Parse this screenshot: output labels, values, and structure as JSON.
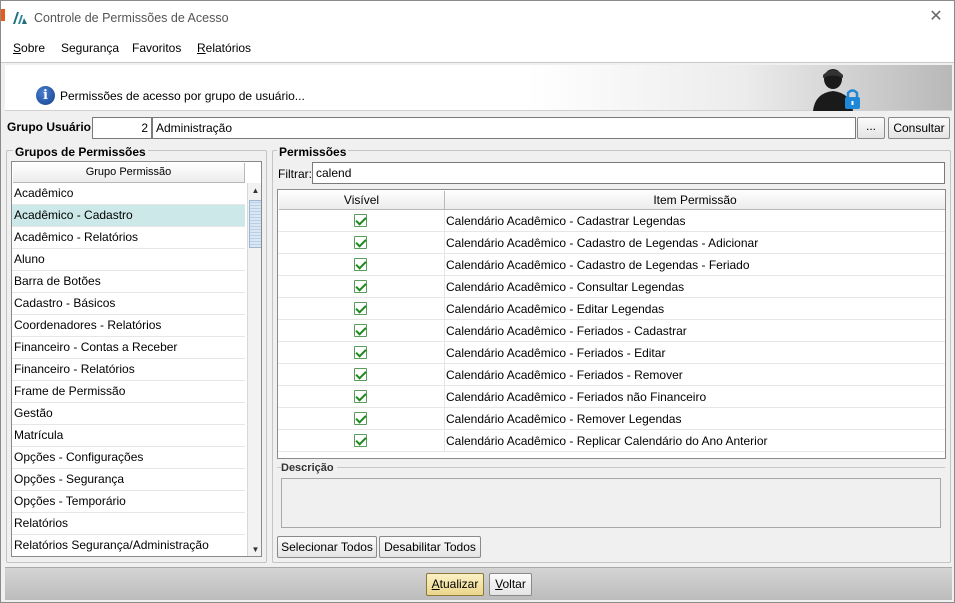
{
  "window": {
    "title": "Controle de Permissões de Acesso",
    "close_glyph": "✕"
  },
  "menu": {
    "items": [
      {
        "mn": "S",
        "rest": "obre"
      },
      {
        "mn": "",
        "rest": "Segurança"
      },
      {
        "mn": "",
        "rest": "Favoritos"
      },
      {
        "mn": "R",
        "rest": "elatórios"
      }
    ]
  },
  "banner": {
    "text": "Permissões de acesso por grupo de usuário...",
    "info_icon": "i"
  },
  "grupo_usuario": {
    "label": "Grupo Usuário:",
    "code": "2",
    "name": "Administração",
    "ellipsis_label": "...",
    "consultar_label": "Consultar"
  },
  "grupos_permissoes": {
    "title": "Grupos de Permissões",
    "column_header": "Grupo Permissão",
    "selected_index": 1,
    "items": [
      "Acadêmico",
      "Acadêmico - Cadastro",
      "Acadêmico - Relatórios",
      "Aluno",
      "Barra de Botões",
      "Cadastro - Básicos",
      "Coordenadores - Relatórios",
      "Financeiro - Contas a Receber",
      "Financeiro - Relatórios",
      "Frame de Permissão",
      "Gestão",
      "Matrícula",
      "Opções - Configurações",
      "Opções - Segurança",
      "Opções - Temporário",
      "Relatórios",
      "Relatórios Segurança/Administração"
    ]
  },
  "permissoes": {
    "title": "Permissões",
    "filter_label": "Filtrar:",
    "filter_value": "calend",
    "columns": [
      "Visível",
      "Item Permissão"
    ],
    "rows": [
      {
        "visible": true,
        "item": "Calendário Acadêmico - Cadastrar Legendas"
      },
      {
        "visible": true,
        "item": "Calendário Acadêmico - Cadastro de Legendas - Adicionar"
      },
      {
        "visible": true,
        "item": "Calendário Acadêmico - Cadastro de Legendas - Feriado"
      },
      {
        "visible": true,
        "item": "Calendário Acadêmico - Consultar Legendas"
      },
      {
        "visible": true,
        "item": "Calendário Acadêmico - Editar Legendas"
      },
      {
        "visible": true,
        "item": "Calendário Acadêmico - Feriados - Cadastrar"
      },
      {
        "visible": true,
        "item": "Calendário Acadêmico - Feriados - Editar"
      },
      {
        "visible": true,
        "item": "Calendário Acadêmico - Feriados - Remover"
      },
      {
        "visible": true,
        "item": "Calendário Acadêmico - Feriados não Financeiro"
      },
      {
        "visible": true,
        "item": "Calendário Acadêmico - Remover Legendas"
      },
      {
        "visible": true,
        "item": "Calendário Acadêmico - Replicar Calendário do Ano Anterior"
      }
    ],
    "descricao_title": "Descrição",
    "selecionar_todos": "Selecionar Todos",
    "desabilitar_todos": "Desabilitar Todos"
  },
  "footer": {
    "atualizar_mn": "A",
    "atualizar_rest": "tualizar",
    "voltar_mn": "V",
    "voltar_rest": "oltar"
  },
  "colors": {
    "selected_row": "#cce8e8",
    "check_green": "#1e8a1e",
    "primary_button": "#ecd68c"
  }
}
